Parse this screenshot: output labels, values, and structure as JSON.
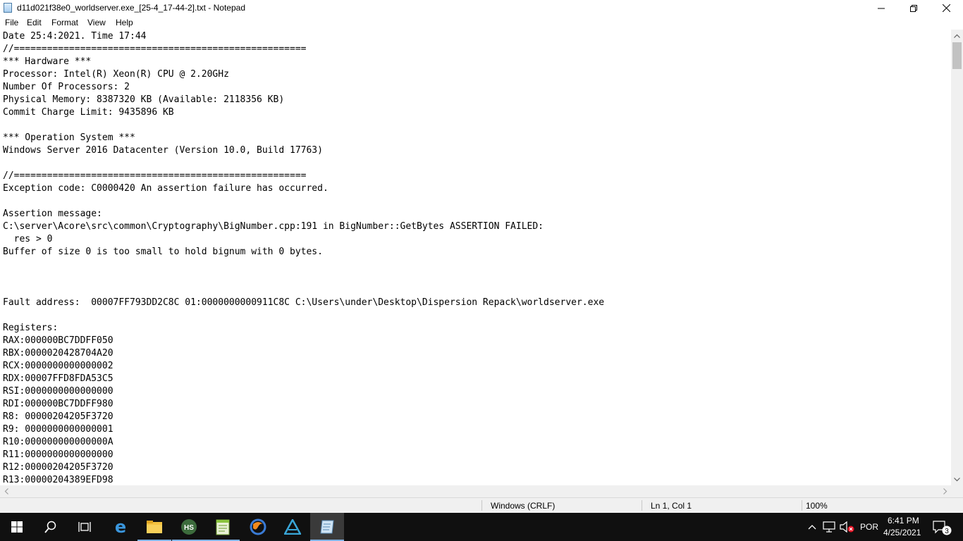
{
  "window": {
    "title": "d11d021f38e0_worldserver.exe_[25-4_17-44-2].txt - Notepad",
    "app_icon": "notepad-icon",
    "controls": {
      "minimize_icon": "minimize-icon",
      "maximize_icon": "restore-icon",
      "close_icon": "close-icon"
    }
  },
  "menu": {
    "file": "File",
    "edit": "Edit",
    "format": "Format",
    "view": "View",
    "help": "Help"
  },
  "document": {
    "text": "Date 25:4:2021. Time 17:44\n//=====================================================\n*** Hardware ***\nProcessor: Intel(R) Xeon(R) CPU @ 2.20GHz\nNumber Of Processors: 2\nPhysical Memory: 8387320 KB (Available: 2118356 KB)\nCommit Charge Limit: 9435896 KB\n\n*** Operation System ***\nWindows Server 2016 Datacenter (Version 10.0, Build 17763)\n\n//=====================================================\nException code: C0000420 An assertion failure has occurred.\n\nAssertion message:\nC:\\server\\Acore\\src\\common\\Cryptography\\BigNumber.cpp:191 in BigNumber::GetBytes ASSERTION FAILED:\n  res > 0\nBuffer of size 0 is too small to hold bignum with 0 bytes.\n\n\n\nFault address:  00007FF793DD2C8C 01:0000000000911C8C C:\\Users\\under\\Desktop\\Dispersion Repack\\worldserver.exe\n\nRegisters:\nRAX:000000BC7DDFF050\nRBX:0000020428704A20\nRCX:0000000000000002\nRDX:00007FFD8FDA53C5\nRSI:0000000000000000\nRDI:000000BC7DDFF980\nR8: 00000204205F3720\nR9: 0000000000000001\nR10:000000000000000A\nR11:0000000000000000\nR12:00000204205F3720\nR13:00000204389EFD98"
  },
  "status": {
    "line_ending": "Windows (CRLF)",
    "position": "Ln 1, Col 1",
    "zoom": "100%"
  },
  "taskbar": {
    "apps": [
      {
        "name": "start-button",
        "icon": "windows-logo-icon"
      },
      {
        "name": "search-button",
        "icon": "search-icon"
      },
      {
        "name": "task-view-button",
        "icon": "task-view-icon"
      },
      {
        "name": "edge-app",
        "icon": "edge-icon"
      },
      {
        "name": "file-explorer-app",
        "icon": "folder-icon"
      },
      {
        "name": "heidisql-app",
        "icon": "hs-icon",
        "label": "HS"
      },
      {
        "name": "notepadpp-app",
        "icon": "notepad-plus-plus-icon"
      },
      {
        "name": "browser-app",
        "icon": "firefox-icon"
      },
      {
        "name": "triangle-app",
        "icon": "triangle-app-icon"
      },
      {
        "name": "notepad-app",
        "icon": "notepad-icon"
      }
    ],
    "tray": {
      "language": "POR",
      "time": "6:41 PM",
      "date": "4/25/2021",
      "notification_count": "3"
    },
    "colors": {
      "background": "#101010",
      "active": "#3a3a3a",
      "underline": "#7fb2e5"
    }
  }
}
